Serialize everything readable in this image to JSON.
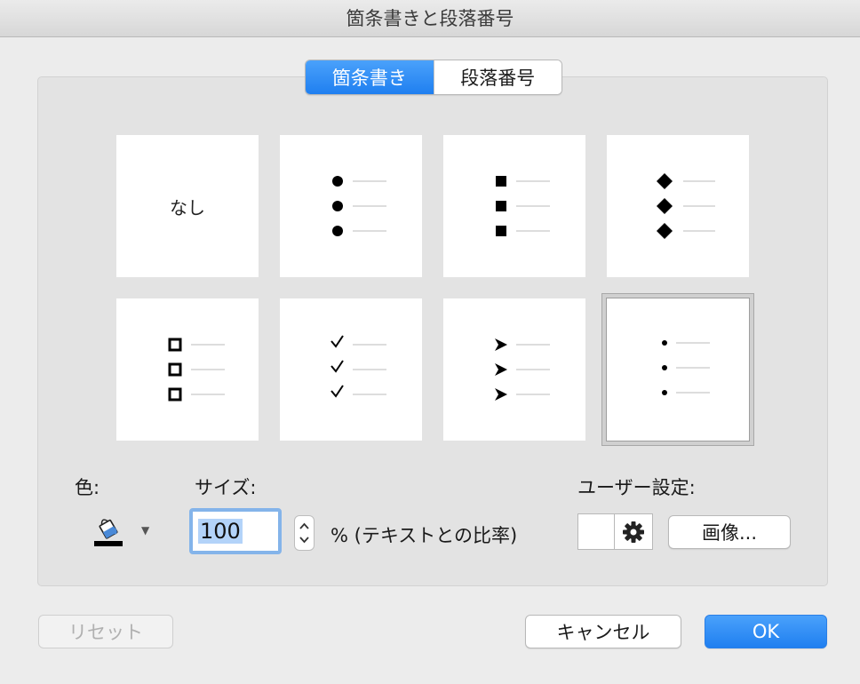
{
  "window": {
    "title": "箇条書きと段落番号"
  },
  "tabs": [
    {
      "label": "箇条書き",
      "active": true
    },
    {
      "label": "段落番号",
      "active": false
    }
  ],
  "bullet_styles": [
    {
      "name": "none",
      "label": "なし"
    },
    {
      "name": "filled-circle"
    },
    {
      "name": "filled-square"
    },
    {
      "name": "filled-diamond"
    },
    {
      "name": "hollow-square"
    },
    {
      "name": "checkmark"
    },
    {
      "name": "arrowhead"
    },
    {
      "name": "small-dot",
      "selected": true
    }
  ],
  "color": {
    "label": "色:",
    "icon": "paint-bucket-icon",
    "value": "#000000"
  },
  "size": {
    "label": "サイズ:",
    "value": "100",
    "unit_label": "% (テキストとの比率)"
  },
  "custom": {
    "label": "ユーザー設定:",
    "image_button": "画像..."
  },
  "buttons": {
    "reset": "リセット",
    "cancel": "キャンセル",
    "ok": "OK"
  },
  "colors": {
    "accent": "#1f7ff0"
  }
}
